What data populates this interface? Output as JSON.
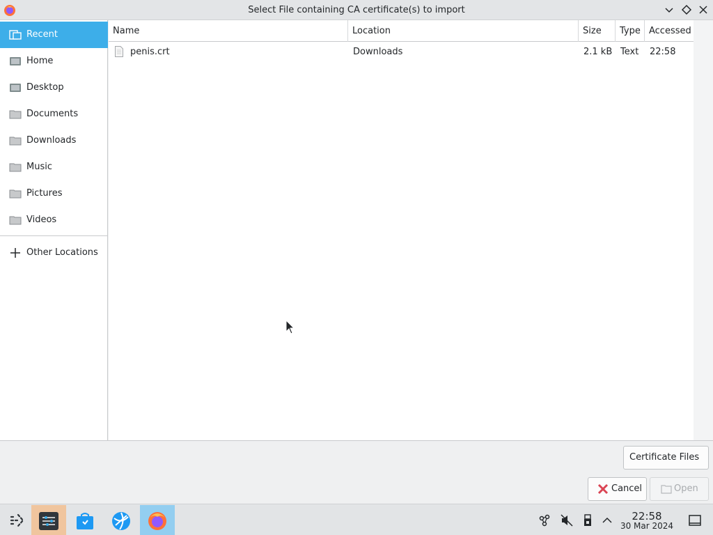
{
  "window": {
    "title": "Select File containing CA certificate(s) to import",
    "app_icon": "firefox-icon",
    "controls": [
      "minimize-icon",
      "maximize-icon",
      "close-icon"
    ]
  },
  "sidebar": {
    "items": [
      {
        "label": "Recent",
        "icon": "recent-icon",
        "active": true
      },
      {
        "label": "Home",
        "icon": "home-icon"
      },
      {
        "label": "Desktop",
        "icon": "desktop-icon"
      },
      {
        "label": "Documents",
        "icon": "folder-icon"
      },
      {
        "label": "Downloads",
        "icon": "folder-icon"
      },
      {
        "label": "Music",
        "icon": "folder-icon"
      },
      {
        "label": "Pictures",
        "icon": "folder-icon"
      },
      {
        "label": "Videos",
        "icon": "folder-icon"
      }
    ],
    "other_locations": {
      "label": "Other Locations",
      "icon": "plus-icon"
    }
  },
  "file_list": {
    "columns": [
      "Name",
      "Location",
      "Size",
      "Type",
      "Accessed"
    ],
    "rows": [
      {
        "name": "penis.crt",
        "location": "Downloads",
        "size": "2.1 kB",
        "type": "Text",
        "accessed": "22:58"
      }
    ]
  },
  "filter": {
    "label": "Certificate Files"
  },
  "actions": {
    "cancel": "Cancel",
    "open": "Open"
  },
  "taskbar": {
    "clock_time": "22:58",
    "clock_date": "30 Mar 2024",
    "apps": [
      "app-launcher-icon",
      "system-settings-icon",
      "discover-store-icon",
      "network-globe-icon",
      "firefox-icon"
    ],
    "tray": [
      "network-icon",
      "volume-muted-icon",
      "usb-device-icon",
      "show-hidden-icon",
      "show-desktop-icon"
    ]
  },
  "colors": {
    "accent": "#3daee9",
    "background": "#eff0f1",
    "list_bg": "#ffffff"
  }
}
